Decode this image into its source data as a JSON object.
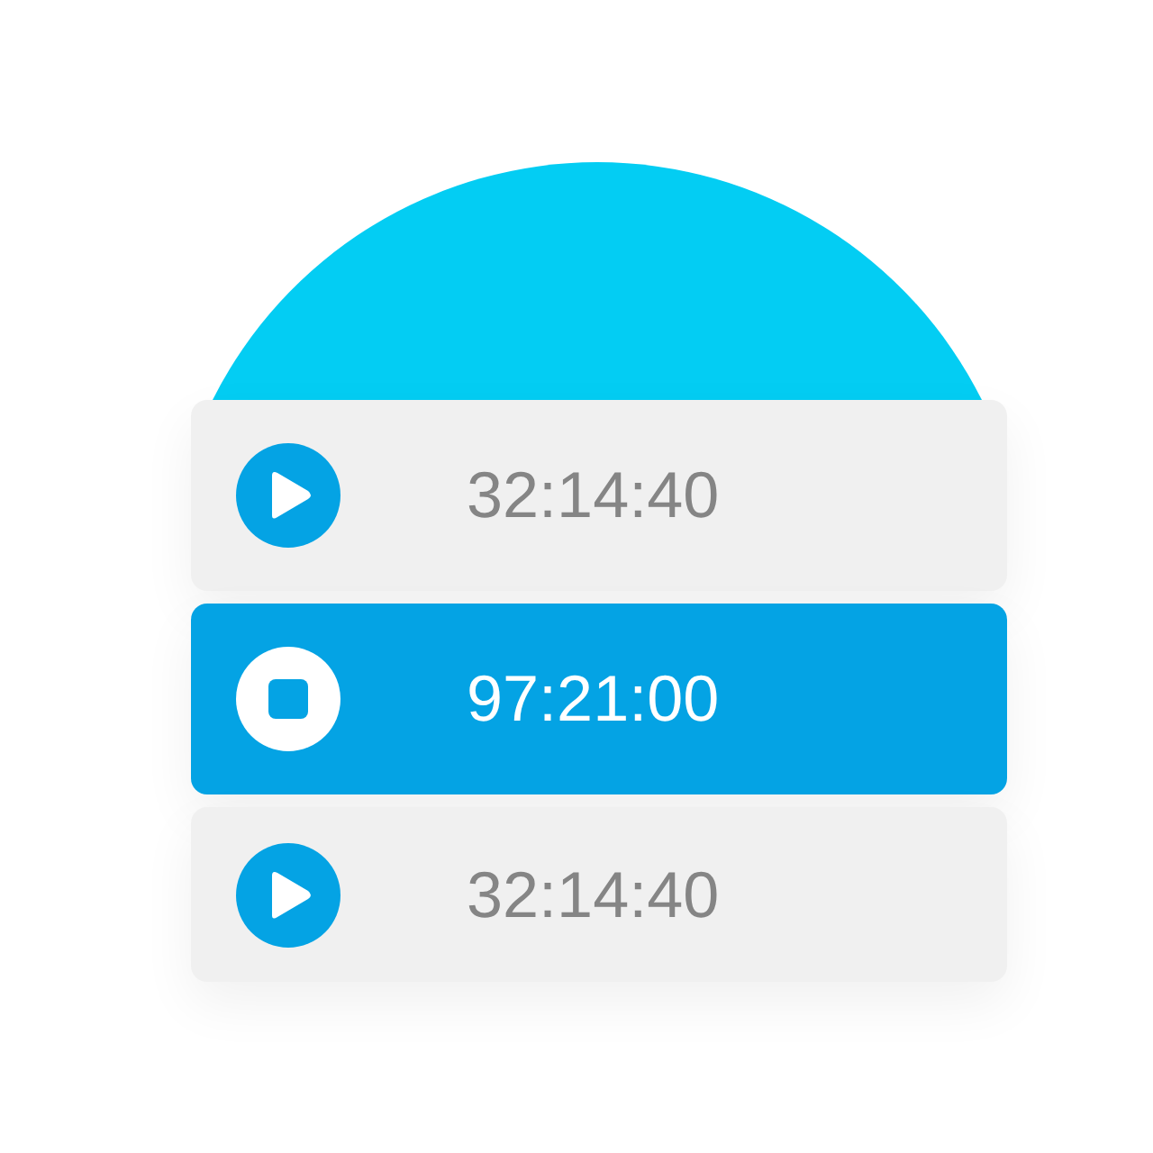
{
  "timers": [
    {
      "time": "32:14:40",
      "running": false
    },
    {
      "time": "97:21:00",
      "running": true
    },
    {
      "time": "32:14:40",
      "running": false
    }
  ]
}
